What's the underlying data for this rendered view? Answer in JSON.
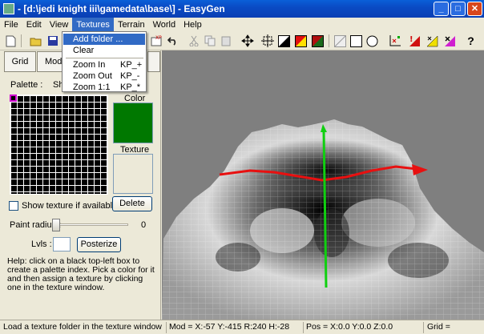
{
  "window": {
    "title": "- [d:\\jedi knight iii\\gamedata\\base\\] - EasyGen"
  },
  "menu": [
    "File",
    "Edit",
    "View",
    "Textures",
    "Terrain",
    "World",
    "Help"
  ],
  "textures_menu": {
    "add_folder": "Add folder ...",
    "clear": "Clear",
    "zoom_in": "Zoom In",
    "zoom_in_key": "KP_+",
    "zoom_out": "Zoom Out",
    "zoom_out_key": "KP_-",
    "zoom_1_1": "Zoom 1:1",
    "zoom_1_1_key": "KP_*"
  },
  "tabs": {
    "grid": "Grid",
    "modify": "Modi",
    "more": ""
  },
  "panel": {
    "palette_label": "Palette :",
    "sh_label": "Sh",
    "color_label": "Color",
    "texture_label": "Texture",
    "selected_color": "#007800",
    "show_texture_label": "Show texture if available",
    "delete_label": "Delete",
    "paint_radius_label": "Paint radius :",
    "paint_radius_value": "0",
    "lvls_label": "Lvls :",
    "posterize_label": "Posterize",
    "help_text": "Help: click on a black top-left box to create a palette index. Pick a color for it and then assign a texture by clicking one in the texture window."
  },
  "status": {
    "message": "Load a texture folder in the texture window",
    "mod": "Mod = X:-57 Y:-415 R:240 H:-28",
    "pos": "Pos = X:0.0 Y:0.0 Z:0.0",
    "grid": "Grid ="
  },
  "colors": {
    "x_axis": "#e81010",
    "y_axis": "#10d010",
    "selection": "#316ac5"
  }
}
